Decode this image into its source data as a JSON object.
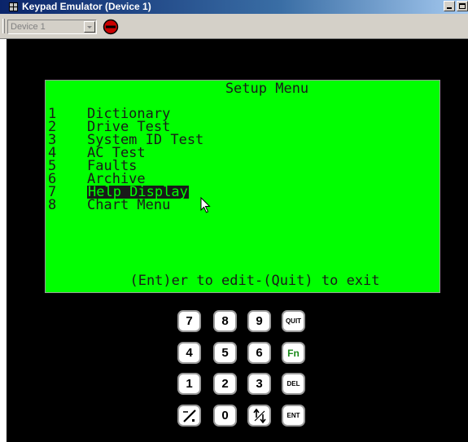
{
  "window": {
    "title": "Keypad Emulator (Device 1)"
  },
  "toolbar": {
    "device_value": "Device 1"
  },
  "lcd": {
    "title": "Setup Menu",
    "menu_items": [
      {
        "num": "1",
        "label": "Dictionary",
        "selected": false
      },
      {
        "num": "2",
        "label": "Drive Test",
        "selected": false
      },
      {
        "num": "3",
        "label": "System ID Test",
        "selected": false
      },
      {
        "num": "4",
        "label": "AC Test",
        "selected": false
      },
      {
        "num": "5",
        "label": "Faults",
        "selected": false
      },
      {
        "num": "6",
        "label": "Archive",
        "selected": false
      },
      {
        "num": "7",
        "label": "Help Display",
        "selected": true
      },
      {
        "num": "8",
        "label": "Chart Menu",
        "selected": false
      }
    ],
    "footer": "(Ent)er to edit-(Quit) to exit",
    "background_color": "#00ff00"
  },
  "keypad": {
    "keys": [
      {
        "label": "7",
        "name": "key-7"
      },
      {
        "label": "8",
        "name": "key-8"
      },
      {
        "label": "9",
        "name": "key-9"
      },
      {
        "label": "QUIT",
        "name": "key-quit"
      },
      {
        "label": "4",
        "name": "key-4"
      },
      {
        "label": "5",
        "name": "key-5"
      },
      {
        "label": "6",
        "name": "key-6"
      },
      {
        "label": "Fn",
        "name": "key-fn"
      },
      {
        "label": "1",
        "name": "key-1"
      },
      {
        "label": "2",
        "name": "key-2"
      },
      {
        "label": "3",
        "name": "key-3"
      },
      {
        "label": "DEL",
        "name": "key-del"
      },
      {
        "label": "",
        "name": "key-decimal-sign",
        "icon": "decimal-sign-icon"
      },
      {
        "label": "0",
        "name": "key-0"
      },
      {
        "label": "",
        "name": "key-up-down",
        "icon": "up-down-arrow-icon"
      },
      {
        "label": "ENT",
        "name": "key-ent"
      }
    ]
  }
}
